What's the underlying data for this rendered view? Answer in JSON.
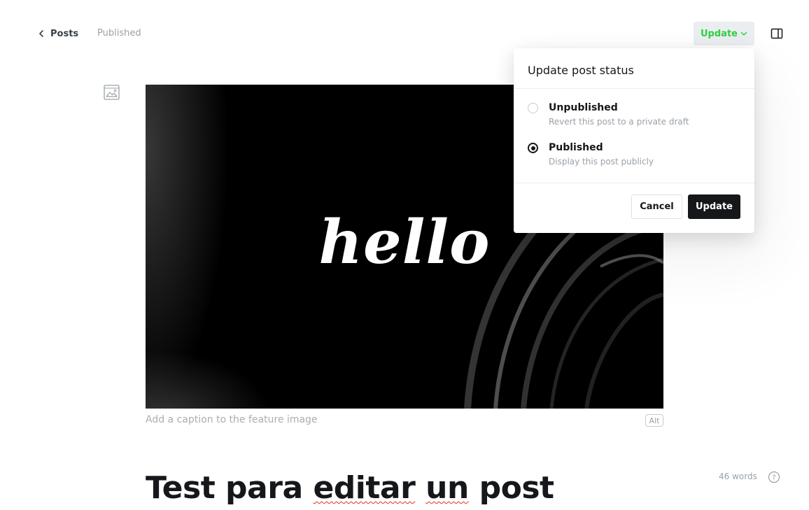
{
  "header": {
    "back_label": "Posts",
    "status": "Published",
    "update_label": "Update"
  },
  "feature_image": {
    "image_text": "hello",
    "caption_placeholder": "Add a caption to the feature image",
    "alt_label": "Alt"
  },
  "post": {
    "title_parts": [
      "Test para ",
      "editar",
      " ",
      "un",
      " post"
    ],
    "word_count": "46 words",
    "help_label": "?"
  },
  "popover": {
    "title": "Update post status",
    "options": [
      {
        "label": "Unpublished",
        "description": "Revert this post to a private draft",
        "selected": false
      },
      {
        "label": "Published",
        "description": "Display this post publicly",
        "selected": true
      }
    ],
    "cancel_label": "Cancel",
    "confirm_label": "Update"
  },
  "colors": {
    "accent_green": "#30cf43",
    "primary_dark": "#15171a",
    "muted_text": "#99a1a9"
  },
  "icons": {
    "back": "chevron-left-icon",
    "dropdown": "chevron-down-icon",
    "sidebar": "sidebar-toggle-icon",
    "image": "image-icon",
    "help": "question-circle-icon"
  }
}
